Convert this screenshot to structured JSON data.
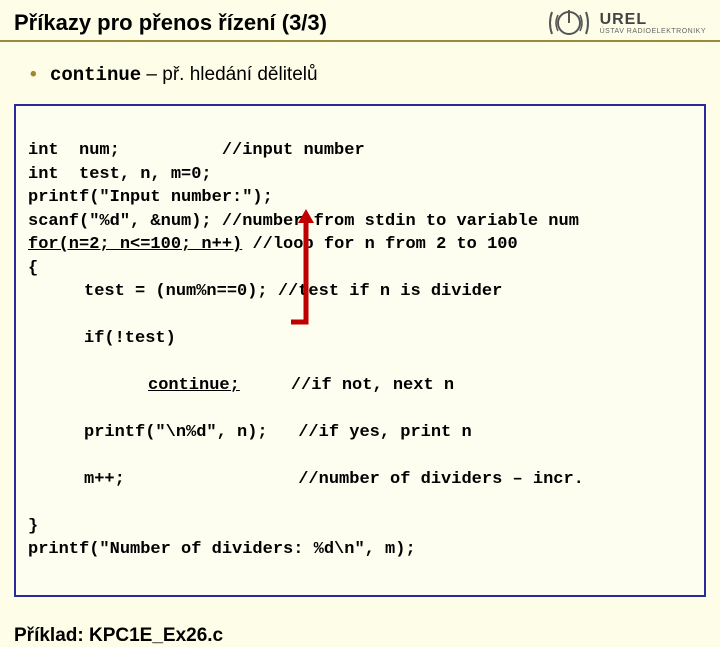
{
  "header": {
    "title": "Příkazy pro přenos řízení (3/3)",
    "logo_big": "UREL",
    "logo_small": "ÚSTAV RADIOELEKTRONIKY"
  },
  "bullet": {
    "keyword": "continue",
    "rest": " – př. hledání dělitelů"
  },
  "code": {
    "l01": "int  num;          //input number",
    "l02": "int  test, n, m=0;",
    "l03": "printf(\"Input number:\");",
    "l04": "scanf(\"%d\", &num); //number from stdin to variable num",
    "l05a": "for(n=2; n<=100; n++)",
    "l05b": " //loop for n from 2 to 100",
    "l06": "{",
    "l07": "test = (num%n==0); //test if n is divider",
    "l08": "if(!test)",
    "l09a": "continue;",
    "l09b": "     //if not, next n",
    "l10": "printf(\"\\n%d\", n);   //if yes, print n",
    "l11": "m++;                 //number of dividers – incr.",
    "l12": "}",
    "l13": "printf(\"Number of dividers: %d\\n\", m);"
  },
  "footer": {
    "label": "Příklad: KPC1E_Ex26.c"
  }
}
